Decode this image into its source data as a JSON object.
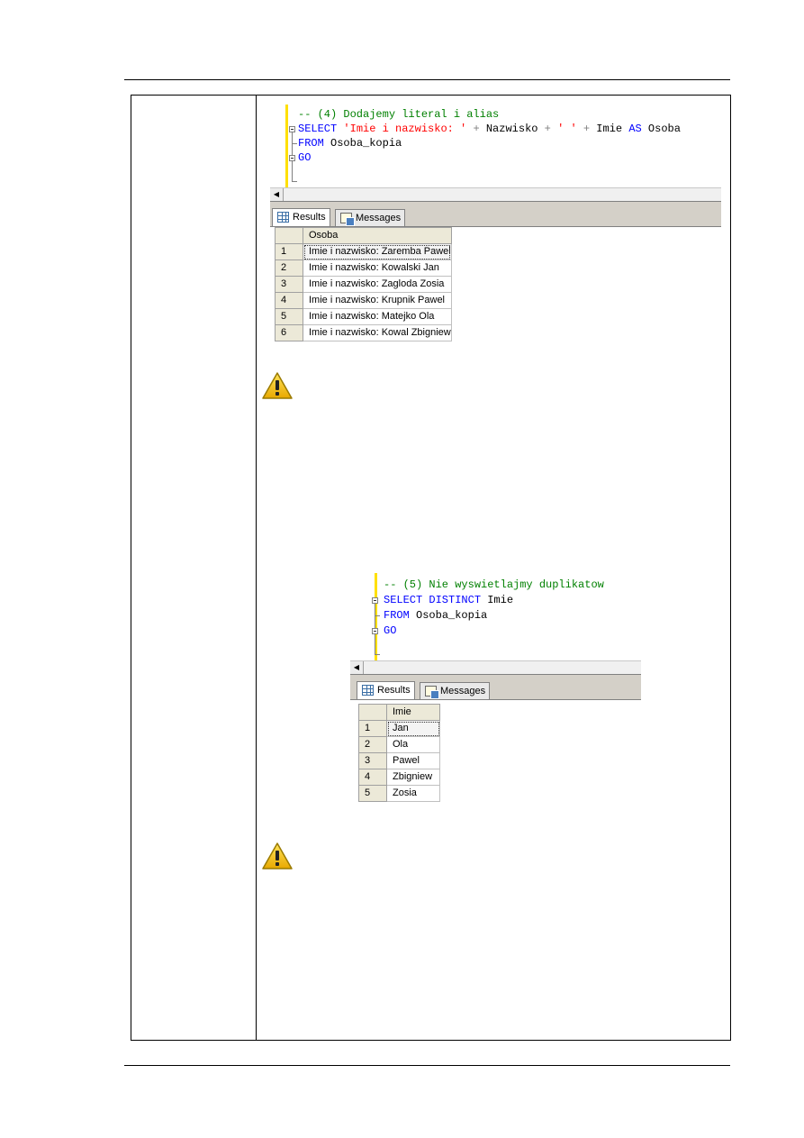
{
  "query1": {
    "code": {
      "l1_comment": "-- (4) Dodajemy literal i alias",
      "l2_select": "SELECT",
      "l2_string": "'Imie i nazwisko: '",
      "l2_plus1": "+",
      "l2_nazwisko": "Nazwisko",
      "l2_plus2": "+",
      "l2_space": "' '",
      "l2_plus3": "+",
      "l2_imie": "Imie",
      "l2_as": "AS",
      "l2_alias": "Osoba",
      "l3_from": "FROM",
      "l3_table": "Osoba_kopia",
      "l4_go": "GO"
    },
    "tabs": {
      "results": "Results",
      "messages": "Messages"
    },
    "column": "Osoba",
    "rows": [
      {
        "n": "1",
        "v": "Imie i nazwisko: Zaremba Pawel"
      },
      {
        "n": "2",
        "v": "Imie i nazwisko: Kowalski Jan"
      },
      {
        "n": "3",
        "v": "Imie i nazwisko: Zagloda Zosia"
      },
      {
        "n": "4",
        "v": "Imie i nazwisko: Krupnik Pawel"
      },
      {
        "n": "5",
        "v": "Imie i nazwisko: Matejko Ola"
      },
      {
        "n": "6",
        "v": "Imie i nazwisko: Kowal Zbigniew"
      }
    ]
  },
  "query2": {
    "code": {
      "l1_comment": "-- (5) Nie wyswietlajmy duplikatow",
      "l2_select": "SELECT DISTINCT",
      "l2_imie": "Imie",
      "l3_from": "FROM",
      "l3_table": "Osoba_kopia",
      "l4_go": "GO"
    },
    "tabs": {
      "results": "Results",
      "messages": "Messages"
    },
    "column": "Imie",
    "rows": [
      {
        "n": "1",
        "v": "Jan"
      },
      {
        "n": "2",
        "v": "Ola"
      },
      {
        "n": "3",
        "v": "Pawel"
      },
      {
        "n": "4",
        "v": "Zbigniew"
      },
      {
        "n": "5",
        "v": "Zosia"
      }
    ]
  },
  "icons": {
    "warning_1": "warning-icon",
    "warning_2": "warning-icon",
    "grid_tab": "grid-icon",
    "messages_tab": "messages-icon"
  },
  "colors": {
    "sql_keyword": "#0000ff",
    "sql_string": "#ff0000",
    "sql_comment": "#008000",
    "sql_operator": "#808080",
    "gutter_marker": "#ffe000",
    "warning_fill": "#f5c400"
  }
}
